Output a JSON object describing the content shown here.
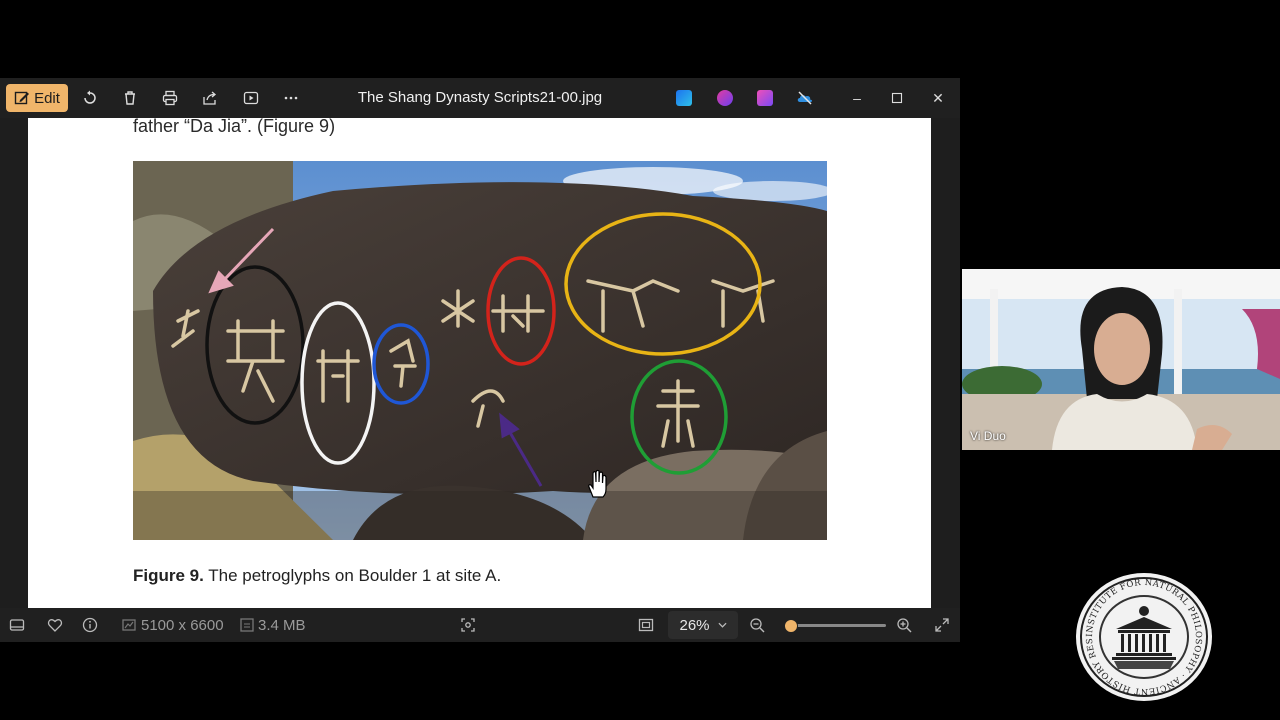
{
  "window": {
    "edit_label": "Edit",
    "title": "The Shang Dynasty Scripts21-00.jpg",
    "toolbar_icons": [
      "rotate-icon",
      "delete-icon",
      "print-icon",
      "share-icon",
      "slideshow-icon",
      "more-icon"
    ],
    "app_icons": [
      "clipchamp-icon",
      "designer-icon",
      "stream-icon",
      "onedrive-icon"
    ],
    "controls": [
      "minimize-icon",
      "maximize-icon",
      "close-icon"
    ]
  },
  "document": {
    "top_text": "father “Da Jia”.  (Figure 9)",
    "caption_bold": "Figure 9.",
    "caption_rest": " The petroglyphs on Boulder 1 at site A."
  },
  "statusbar": {
    "dimensions": "5100 x 6600",
    "file_size": "3.4 MB",
    "zoom": "26%",
    "zoom_level": 0.04
  },
  "video": {
    "participant_name": "Vi Duo"
  },
  "seal": {
    "text": "INSTITUTE FOR NATURAL PHILOSOPHY · ANCIENT HISTORY RESEARCH CENTER"
  },
  "colors": {
    "accent": "#f0b56a",
    "circle_black": "#111111",
    "circle_white": "#f4f4f4",
    "circle_blue": "#1f57d6",
    "circle_red": "#d3231b",
    "circle_yellow": "#e8b415",
    "circle_green": "#1f9e35",
    "arrow_pink": "#e6a7b8",
    "arrow_purple": "#4b2a86"
  }
}
